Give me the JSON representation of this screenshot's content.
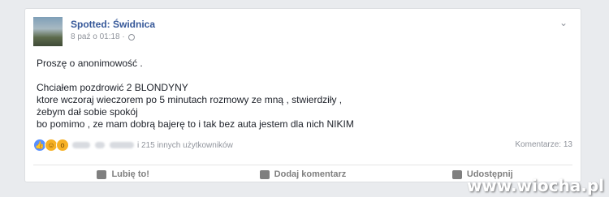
{
  "post": {
    "page_name": "Spotted: Świdnica",
    "timestamp": "8 paź o 01:18 ·",
    "lines": [
      "Proszę o anonimowość .",
      "Chciałem pozdrowić 2 BLONDYNY",
      "ktore wczoraj wieczorem po 5 minutach rozmowy ze mną , stwierdziły ,",
      "żebym dał sobie spokój",
      "bo pomimo , ze mam dobrą bajerę to i tak bez auta jestem dla nich NIKIM"
    ]
  },
  "reactions": {
    "summary": "i 215 innych użytkowników",
    "comments": "Komentarze: 13",
    "icons": [
      "like-icon",
      "haha-icon",
      "wow-icon"
    ]
  },
  "actions": {
    "like_label": "Lubię to!",
    "comment_label": "Dodaj komentarz",
    "share_label": "Udostępnij"
  },
  "watermark": "www.wiocha.pl",
  "colors": {
    "page_name": "#365899",
    "like_blue": "#5890ff",
    "muted": "#90949c"
  }
}
